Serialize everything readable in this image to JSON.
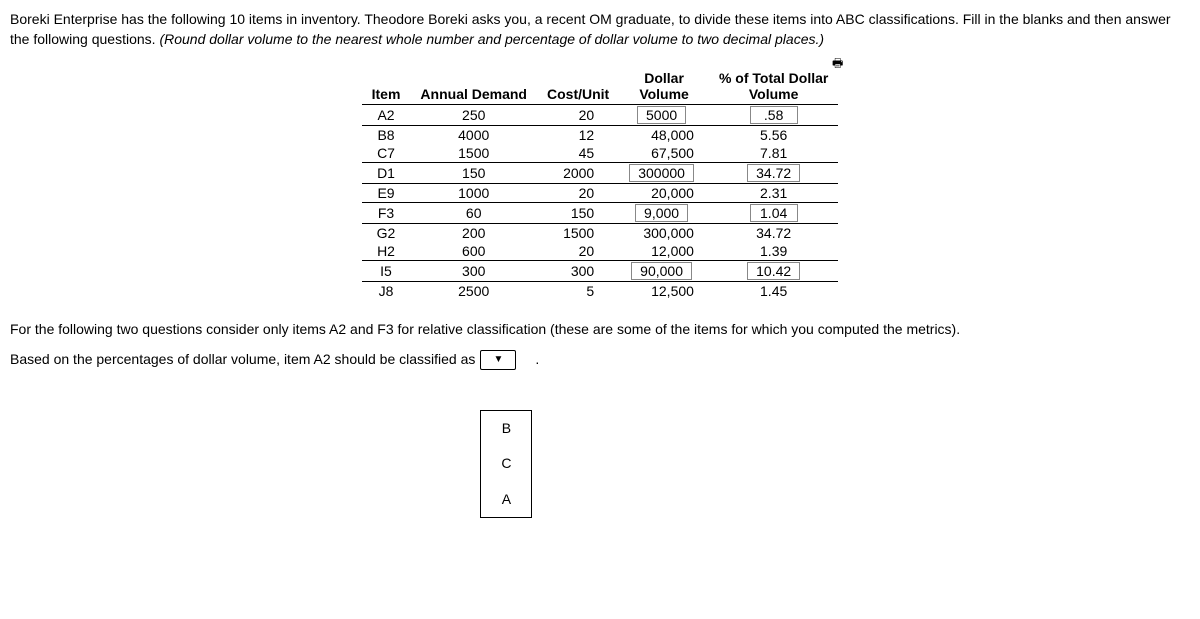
{
  "question": {
    "text_part1": "Boreki Enterprise has the following 10 items in inventory. Theodore Boreki asks you, a recent OM graduate, to divide these items into ABC classifications. Fill in the blanks and then answer the following questions. ",
    "text_italic": "(Round dollar volume to the nearest whole number and percentage of dollar volume to two decimal places.)"
  },
  "table": {
    "headers": {
      "item": "Item",
      "annual_demand": "Annual Demand",
      "cost_unit": "Cost/Unit",
      "dollar_volume": "Dollar Volume",
      "pct_total": "% of Total Dollar Volume"
    },
    "rows": [
      {
        "item": "A2",
        "demand": "250",
        "cost": "20",
        "dv": "5000",
        "dv_box": true,
        "pct": ".58",
        "pct_box": true,
        "border": true
      },
      {
        "item": "B8",
        "demand": "4000",
        "cost": "12",
        "dv": "48,000",
        "dv_box": false,
        "pct": "5.56",
        "pct_box": false,
        "border": false
      },
      {
        "item": "C7",
        "demand": "1500",
        "cost": "45",
        "dv": "67,500",
        "dv_box": false,
        "pct": "7.81",
        "pct_box": false,
        "border": true
      },
      {
        "item": "D1",
        "demand": "150",
        "cost": "2000",
        "dv": "300000",
        "dv_box": true,
        "pct": "34.72",
        "pct_box": true,
        "border": true
      },
      {
        "item": "E9",
        "demand": "1000",
        "cost": "20",
        "dv": "20,000",
        "dv_box": false,
        "pct": "2.31",
        "pct_box": false,
        "border": true
      },
      {
        "item": "F3",
        "demand": "60",
        "cost": "150",
        "dv": "9,000",
        "dv_box": true,
        "pct": "1.04",
        "pct_box": true,
        "border": true
      },
      {
        "item": "G2",
        "demand": "200",
        "cost": "1500",
        "dv": "300,000",
        "dv_box": false,
        "pct": "34.72",
        "pct_box": false,
        "border": false
      },
      {
        "item": "H2",
        "demand": "600",
        "cost": "20",
        "dv": "12,000",
        "dv_box": false,
        "pct": "1.39",
        "pct_box": false,
        "border": true
      },
      {
        "item": "I5",
        "demand": "300",
        "cost": "300",
        "dv": "90,000",
        "dv_box": true,
        "pct": "10.42",
        "pct_box": true,
        "border": true
      },
      {
        "item": "J8",
        "demand": "2500",
        "cost": "5",
        "dv": "12,500",
        "dv_box": false,
        "pct": "1.45",
        "pct_box": false,
        "border": false
      }
    ]
  },
  "instruction_text": "For the following two questions consider only items A2 and F3 for relative classification (these are some of the items for which you computed the metrics).",
  "classify_text": "Based on the percentages of dollar volume, item A2 should be classified as",
  "dropdown": {
    "selected": "▼",
    "options": [
      "B",
      "C",
      "A"
    ]
  },
  "print_icon": "🖶"
}
